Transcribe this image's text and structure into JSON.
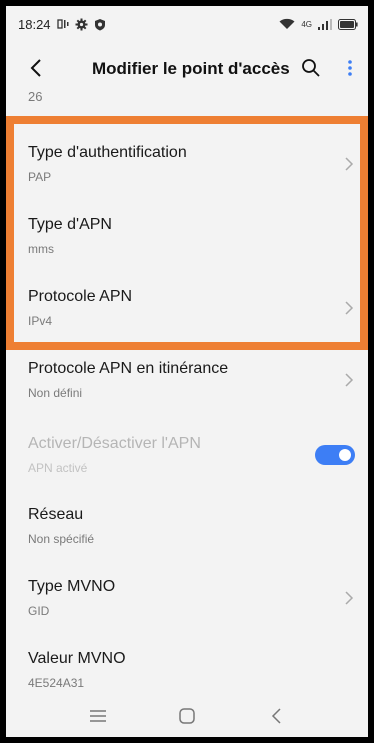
{
  "status_bar": {
    "time": "18:24",
    "network_label": "4G",
    "icons": [
      "notification-icon",
      "gear-icon",
      "shield-icon",
      "wifi-icon",
      "signal-icon",
      "battery-icon"
    ]
  },
  "app_bar": {
    "title": "Modifier le point d'accès",
    "icons": [
      "back-arrow-icon",
      "search-icon",
      "more-vert-icon"
    ]
  },
  "previous_value": "26",
  "settings": [
    {
      "label": "Type d'authentification",
      "value": "PAP",
      "control": "chevron",
      "enabled": true
    },
    {
      "label": "Type d'APN",
      "value": "mms",
      "control": "none",
      "enabled": true
    },
    {
      "label": "Protocole APN",
      "value": "IPv4",
      "control": "chevron",
      "enabled": true
    },
    {
      "label": "Protocole APN en itinérance",
      "value": "Non défini",
      "control": "chevron",
      "enabled": true
    },
    {
      "label": "Activer/Désactiver l'APN",
      "value": "APN activé",
      "control": "toggle",
      "toggle_on": true,
      "enabled": false
    },
    {
      "label": "Réseau",
      "value": "Non spécifié",
      "control": "none",
      "enabled": true
    },
    {
      "label": "Type MVNO",
      "value": "GID",
      "control": "chevron",
      "enabled": true
    },
    {
      "label": "Valeur MVNO",
      "value": "4E524A31",
      "control": "none",
      "enabled": true
    }
  ],
  "nav_bar": {
    "icons": [
      "menu-icon",
      "home-icon",
      "back-icon"
    ]
  },
  "colors": {
    "accent": "#3d7ef5",
    "highlight": "#ee7f33",
    "background": "#f3f3f3"
  }
}
